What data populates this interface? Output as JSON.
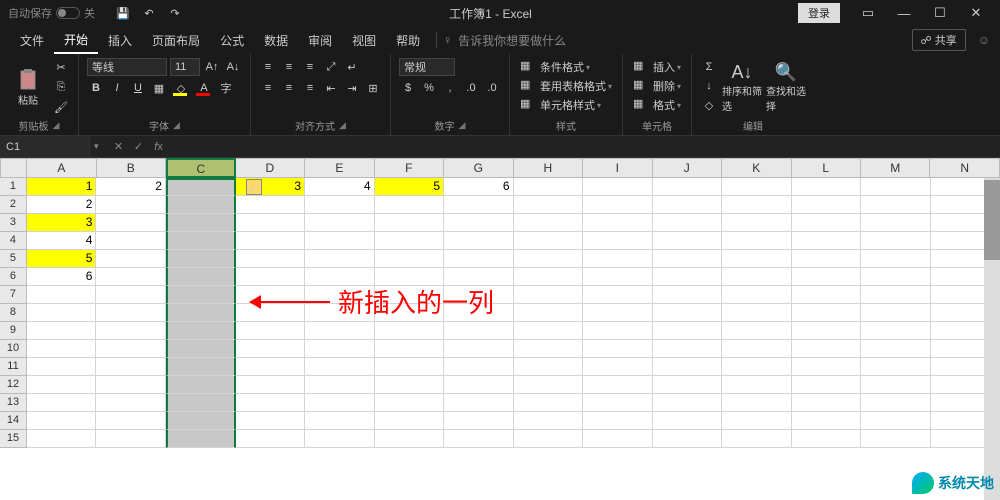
{
  "titlebar": {
    "autosave_label": "自动保存",
    "autosave_off": "关",
    "title": "工作簿1 - Excel",
    "login": "登录"
  },
  "menu": {
    "file": "文件",
    "home": "开始",
    "insert": "插入",
    "layout": "页面布局",
    "formulas": "公式",
    "data": "数据",
    "review": "审阅",
    "view": "视图",
    "help": "帮助",
    "tellme": "告诉我你想要做什么",
    "share": "共享"
  },
  "ribbon": {
    "clipboard": {
      "paste": "粘贴",
      "label": "剪贴板"
    },
    "font": {
      "name": "等线",
      "size": "11",
      "label": "字体"
    },
    "align": {
      "label": "对齐方式"
    },
    "number": {
      "format": "常规",
      "label": "数字"
    },
    "styles": {
      "conditional": "条件格式",
      "table": "套用表格格式",
      "cell": "单元格样式",
      "label": "样式"
    },
    "cells": {
      "insert": "插入",
      "delete": "删除",
      "format": "格式",
      "label": "单元格"
    },
    "editing": {
      "sort": "排序和筛选",
      "find": "查找和选择",
      "label": "编辑"
    }
  },
  "namebox": "C1",
  "columns": [
    "A",
    "B",
    "C",
    "D",
    "E",
    "F",
    "G",
    "H",
    "I",
    "J",
    "K",
    "L",
    "M",
    "N"
  ],
  "selected_col": 2,
  "rows": [
    1,
    2,
    3,
    4,
    5,
    6,
    7,
    8,
    9,
    10,
    11,
    12,
    13,
    14,
    15
  ],
  "cells": {
    "A1": {
      "v": "1",
      "yellow": true
    },
    "B1": {
      "v": "2"
    },
    "D1": {
      "v": "3",
      "yellow": true
    },
    "E1": {
      "v": "4"
    },
    "F1": {
      "v": "5",
      "yellow": true
    },
    "G1": {
      "v": "6"
    },
    "A2": {
      "v": "2"
    },
    "A3": {
      "v": "3",
      "yellow": true
    },
    "A4": {
      "v": "4"
    },
    "A5": {
      "v": "5",
      "yellow": true
    },
    "A6": {
      "v": "6"
    }
  },
  "annotation": "新插入的一列",
  "watermark": "系统天地"
}
